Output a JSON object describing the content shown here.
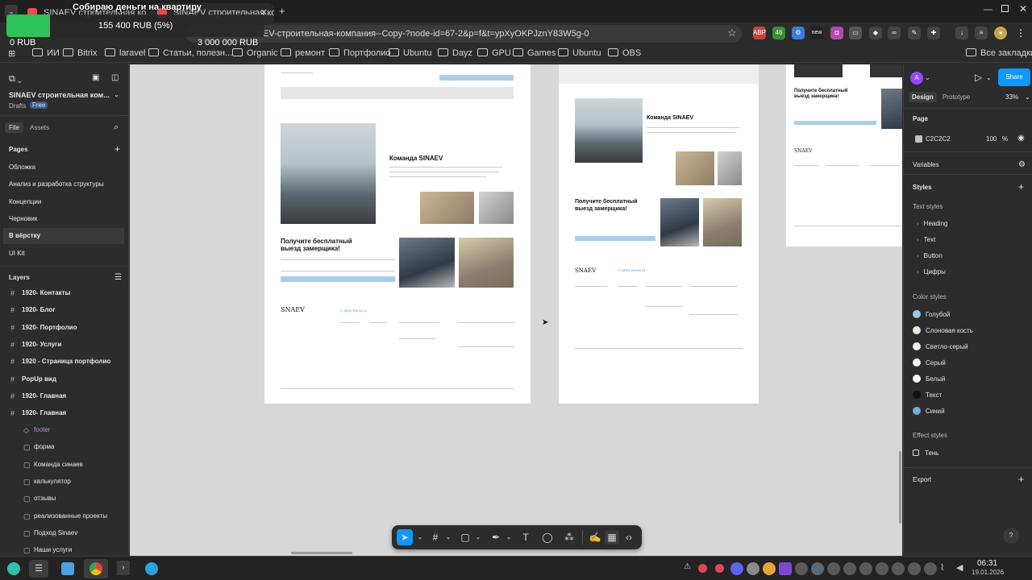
{
  "donation": {
    "title": "Собираю деньги на квартиру",
    "raised": "155 400 RUB (5%)",
    "current": "0 RUB",
    "goal": "3 000 000 RUB",
    "progress_percent": 5
  },
  "tabs": [
    {
      "label": "SINAEV строительная ко..."
    },
    {
      "label": "SINAEV строительная комп"
    }
  ],
  "address": {
    "url": "EV-строительная-компания--Copy-?node-id=67-2&p=f&t=ypXyOKPJznY83W5g-0"
  },
  "extensions": [
    {
      "label": "ABP",
      "color": "#d43b3b"
    },
    {
      "label": "46",
      "color": "#3a8a3a"
    },
    {
      "label": "new",
      "color": "#222"
    }
  ],
  "bookmarks": [
    "ИИ",
    "Bitrix",
    "laravel",
    "Статьи, полезн...",
    "Organic",
    "ремонт",
    "Портфолио",
    "Ubuntu",
    "Dayz",
    "GPU",
    "Games",
    "Ubuntu",
    "OBS"
  ],
  "bookmarks_all": "Все закладки",
  "left": {
    "project": "SINAEV строительная ком...",
    "drafts": "Drafts",
    "plan": "Free",
    "tab_file": "File",
    "tab_assets": "Assets",
    "pages_title": "Pages",
    "pages": [
      "Обложка",
      "Анализ и разработка структуры",
      "Концепции",
      "Черновик",
      "В вёрстку",
      "UI Kit"
    ],
    "layers_title": "Layers",
    "frames": [
      "1920- Контакты",
      "1920- Блог",
      "1920- Портфолио",
      "1920- Услуги",
      "1920 - Страница портфолио",
      "PopUp вид",
      "1920- Главная",
      "1920- Главная"
    ],
    "children": [
      "footer",
      "форма",
      "Команда синаев",
      "калькулятор",
      "отзывы",
      "реализованные проекты",
      "Подход Sinaev",
      "Наши услуги"
    ]
  },
  "canvas": {
    "frame1": {
      "team_title": "Команда SINAEV",
      "cta_title_1": "Получите бесплатный",
      "cta_title_2": "выезд замерщика!",
      "phone": "+7 (900) 300-00-13",
      "logo": "SNAEV"
    },
    "frame2": {
      "team_title": "Команда SINAEV",
      "cta_title_1": "Получите бесплатный",
      "cta_title_2": "выезд замерщика!",
      "phone": "+7 (900) 300-00-13",
      "logo": "SNAEV"
    },
    "frame3": {
      "cta_title_1": "Получите бесплатный",
      "cta_title_2": "выезд замерщика!",
      "logo": "SNAEV"
    }
  },
  "right": {
    "avatar": "A",
    "share": "Share",
    "tab_design": "Design",
    "tab_prototype": "Prototype",
    "zoom": "33%",
    "page_title": "Page",
    "page_color": "C2C2C2",
    "page_opacity": "100",
    "percent": "%",
    "variables": "Variables",
    "styles": "Styles",
    "text_styles": "Text styles",
    "text_style_items": [
      "Heading",
      "Text",
      "Button",
      "Цифры"
    ],
    "color_styles": "Color styles",
    "colors": [
      {
        "name": "Голубой",
        "hex": "#9cc8e8"
      },
      {
        "name": "Слоновая кость",
        "hex": "#ece4d8"
      },
      {
        "name": "Светло-серый",
        "hex": "#eeeeee"
      },
      {
        "name": "Серый",
        "hex": "#f4f4f4"
      },
      {
        "name": "Белый",
        "hex": "#ffffff"
      },
      {
        "name": "Текст",
        "hex": "#111111"
      },
      {
        "name": "Синий",
        "hex": "#6aaee0"
      }
    ],
    "effect_styles": "Effect styles",
    "effects": [
      "Тень"
    ],
    "export": "Export",
    "help": "?"
  },
  "taskbar": {
    "time": "06:31",
    "date": "19.01.2026"
  }
}
